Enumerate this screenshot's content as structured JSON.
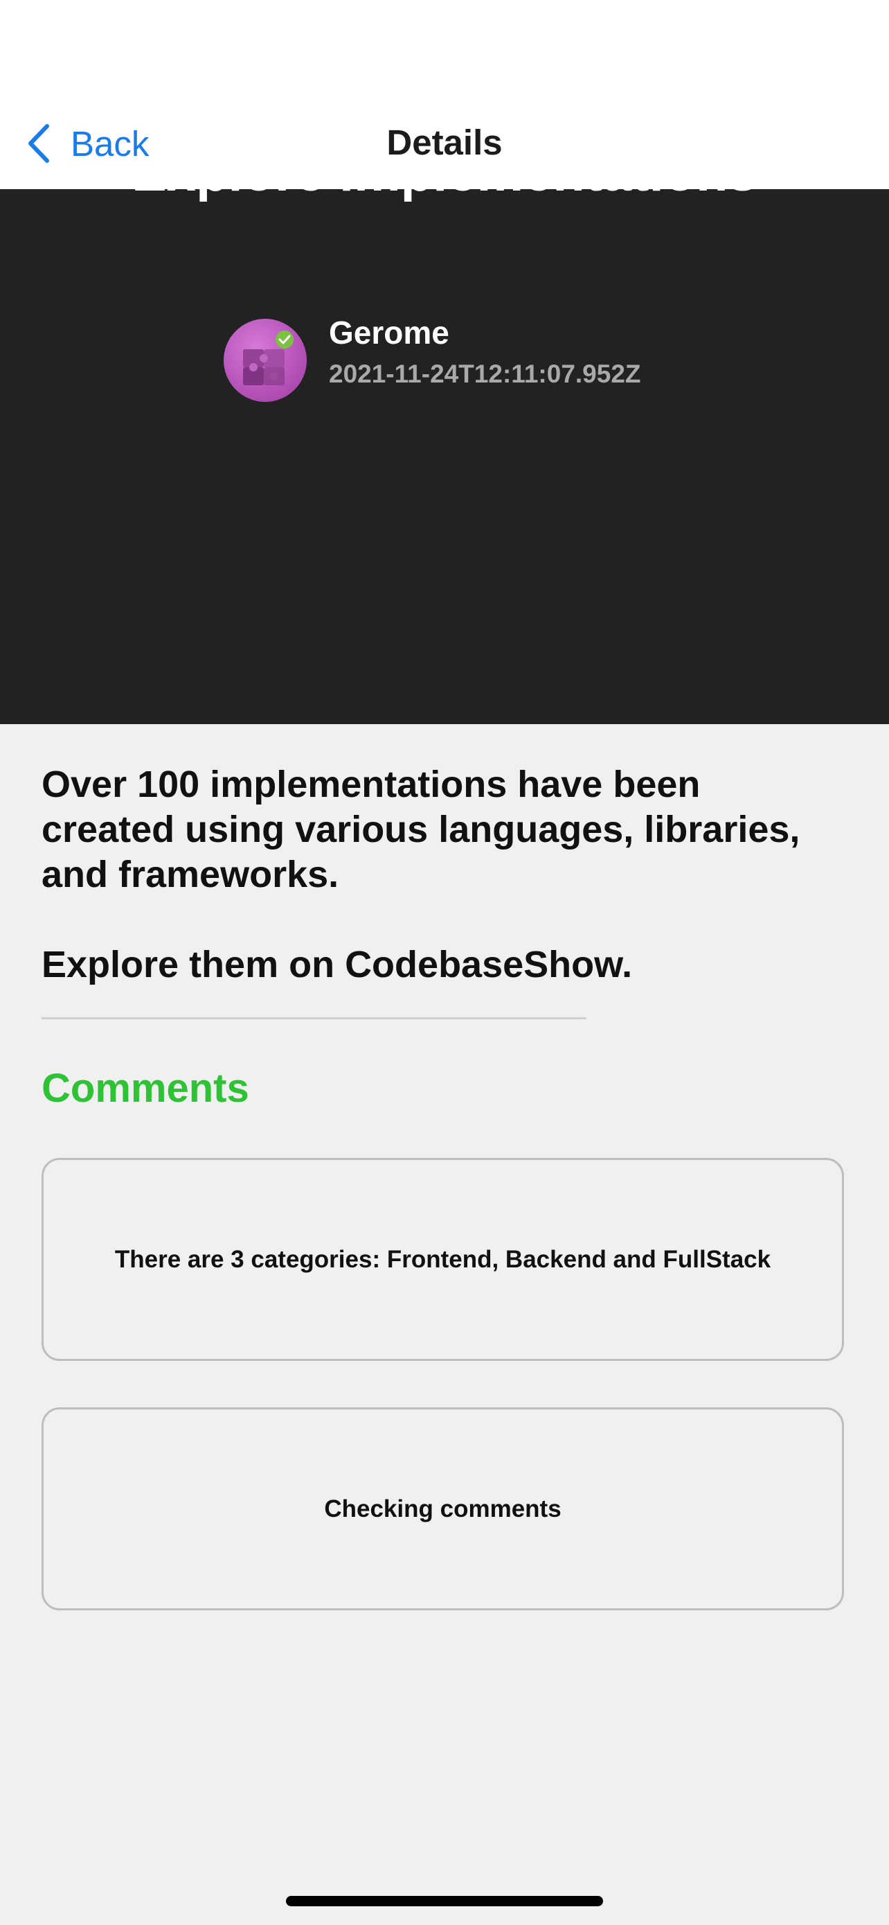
{
  "nav": {
    "back_label": "Back",
    "title": "Details"
  },
  "article": {
    "hero_title": "Explore implementations",
    "author_name": "Gerome",
    "author_date": "2021-11-24T12:11:07.952Z",
    "body": [
      "Over 100 implementations have been\ncreated using various languages, libraries,\nand frameworks.",
      "Explore them on CodebaseShow."
    ]
  },
  "comments": {
    "heading": "Comments",
    "items": [
      {
        "text": "There are 3 categories: Frontend, Backend and FullStack"
      },
      {
        "text": "Checking comments"
      }
    ]
  },
  "colors": {
    "accent_blue": "#1a7bea",
    "comments_green": "#2ec335",
    "hero_background": "#222222",
    "page_background": "#f0f0f0"
  },
  "icons": {
    "back": "chevron-left-icon",
    "avatar": "puzzle-icon"
  }
}
